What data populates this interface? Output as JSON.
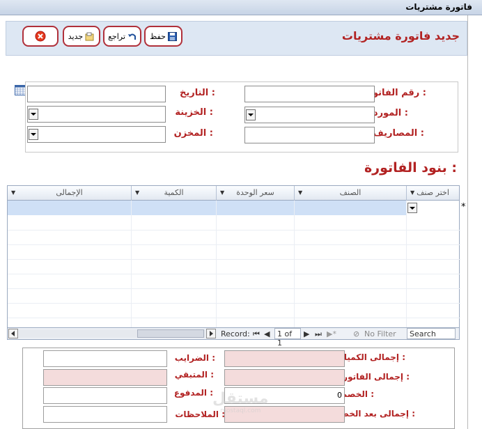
{
  "window": {
    "title": "فاتورة مشتريات"
  },
  "form": {
    "title": "جديد فاتورة مشتريات"
  },
  "toolbar": {
    "save_label": "حفظ",
    "undo_label": "تراجع",
    "new_label": "جديد"
  },
  "fields": {
    "invoice_number_label": "رقم الفاتورة :",
    "invoice_number_value": "",
    "date_label": "التاريخ :",
    "date_value": "",
    "supplier_label": "المورد :",
    "supplier_value": "",
    "treasury_label": "الخزينة :",
    "treasury_value": "",
    "expenses_label": "المصاريف :",
    "expenses_value": "",
    "store_label": "المخزن :",
    "store_value": ""
  },
  "items_section": {
    "title": "بنود الفاتورة :"
  },
  "grid": {
    "columns": [
      "اختر صنف",
      "الصنف",
      "سعر الوحدة",
      "الكمية",
      "الإجمالى"
    ],
    "new_row_marker": "*",
    "rows": []
  },
  "navigation": {
    "record_label": "Record:",
    "record_position": "1 of 1",
    "filter_label": "No Filter",
    "search_placeholder": "Search"
  },
  "totals": {
    "quantities_total_label": "إجمالى الكميات :",
    "quantities_total_value": "",
    "invoice_total_label": "إجمالى الفاتورة :",
    "invoice_total_value": "",
    "discount_label": "الخصم :",
    "discount_value": "0",
    "after_discount_label": "إجمالى بعد الخصم :",
    "after_discount_value": "",
    "taxes_label": "الضرايب :",
    "taxes_value": "",
    "remaining_label": "المتبقي :",
    "remaining_value": "",
    "paid_label": "المدفوع :",
    "paid_value": "",
    "notes_label": "الملاحظات :",
    "notes_value": ""
  },
  "watermark": {
    "text": "مستقل",
    "subtext": "mostaql.com"
  },
  "colors": {
    "accent": "#b22222",
    "header_bg": "#dde7f3",
    "pink_field": "#f4dcdc",
    "grid_selected": "#cfe0f6"
  },
  "icons": [
    "close-icon",
    "undo-icon",
    "new-icon",
    "save-icon",
    "calendar-icon",
    "dropdown-arrow-icon"
  ]
}
